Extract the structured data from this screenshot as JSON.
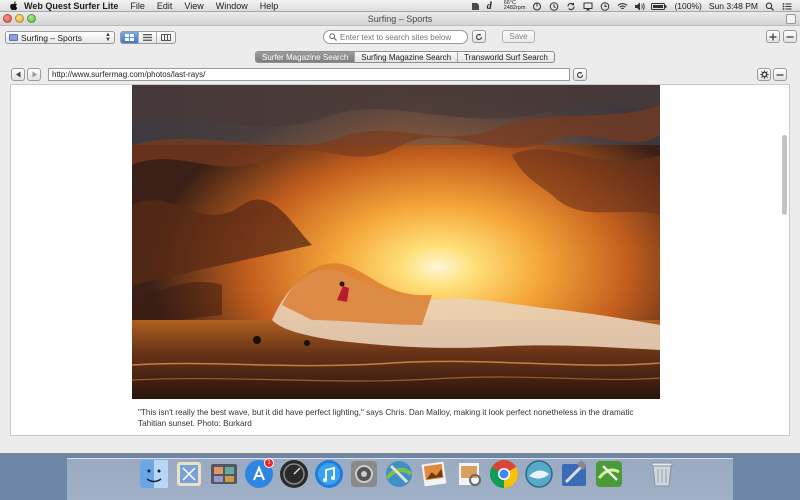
{
  "menubar": {
    "app_name": "Web Quest Surfer Lite",
    "items": [
      "File",
      "Edit",
      "View",
      "Window",
      "Help"
    ],
    "temperature": "66°C",
    "fan_speed": "2482rpm",
    "battery": "(100%)",
    "clock": "Sun 3:48 PM"
  },
  "window": {
    "title": "Surfing – Sports"
  },
  "toolbar": {
    "category_selected": "Surfing – Sports",
    "search_placeholder": "Enter text to search sites below",
    "save_label": "Save"
  },
  "tabs": [
    {
      "label": "Surfer Magazine Search",
      "active": true
    },
    {
      "label": "Surfing Magazine Search",
      "active": false
    },
    {
      "label": "Transworld Surf Search",
      "active": false
    }
  ],
  "browser": {
    "url": "http://www.surfermag.com/photos/last-rays/"
  },
  "page": {
    "caption": "\"This isn't really the best wave, but it did have perfect lighting,\" says Chris. Dan Malloy, making it look perfect nonetheless in the dramatic Tahitian sunset. Photo: Burkard"
  },
  "dock": {
    "icons": [
      "finder-icon",
      "mail-icon",
      "photo-browser-icon",
      "app-store-icon",
      "dashboard-icon",
      "itunes-icon",
      "system-preferences-icon",
      "web-quest-surfer-icon",
      "iphoto-icon",
      "preview-icon",
      "chrome-icon",
      "web-quest-icon",
      "xcode-icon",
      "surf-app-icon",
      "trash-icon"
    ],
    "app_store_badge": "1"
  }
}
